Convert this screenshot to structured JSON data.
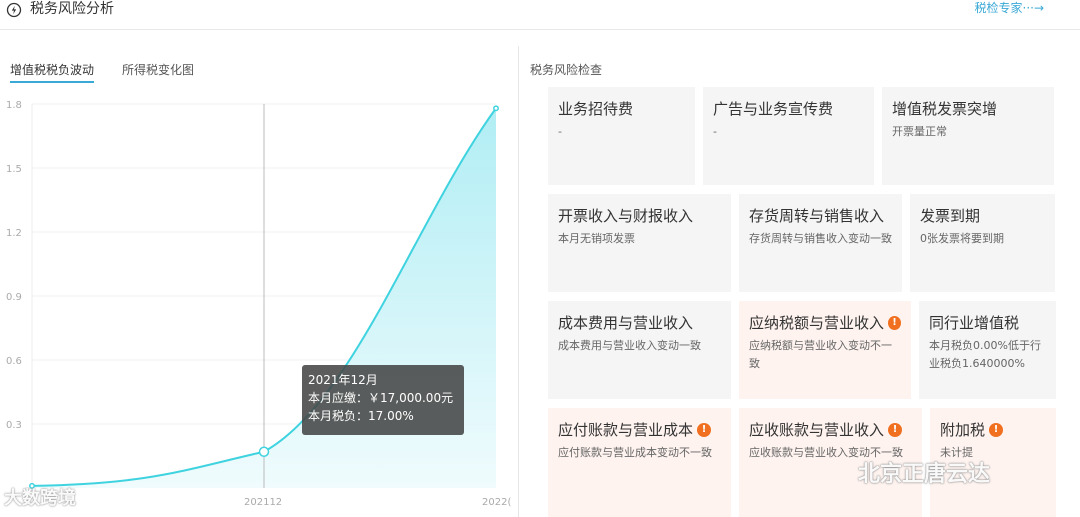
{
  "header": {
    "title": "税务风险分析",
    "icon": "lightning-circle-icon",
    "expert_link": "税检专家···→"
  },
  "tabs": [
    {
      "label": "增值税税负波动",
      "active": true
    },
    {
      "label": "所得税变化图",
      "active": false
    }
  ],
  "chart_data": {
    "type": "area",
    "x": [
      "",
      "202112",
      "2022"
    ],
    "x_tick_labels": [
      "202112",
      "2022("
    ],
    "y_ticks": [
      "1.8",
      "1.5",
      "1.2",
      "0.9",
      "0.6",
      "0.3"
    ],
    "ylim": [
      0,
      1.8
    ],
    "series": [
      {
        "points": [
          [
            0,
            0.01
          ],
          [
            0.5,
            0.17
          ],
          [
            1,
            1.78
          ]
        ]
      }
    ],
    "highlight_index": 1,
    "colors": {
      "line": "#3fd3e0",
      "fill_top": "#a8ecf3",
      "fill_bottom": "#eefbfd",
      "cursor": "#bbbbbb"
    }
  },
  "tooltip": {
    "date": "2021年12月",
    "payable": "本月应缴：￥17,000.00元",
    "burden": "本月税负：17.00%"
  },
  "risk": {
    "title": "税务风险检查",
    "cards": [
      {
        "title": "业务招待费",
        "desc": "-",
        "warn": false
      },
      {
        "title": "广告与业务宣传费",
        "desc": "-",
        "warn": false
      },
      {
        "title": "增值税发票突增",
        "desc": "开票量正常",
        "warn": false
      },
      {
        "title": "开票收入与财报收入",
        "desc": "本月无销项发票",
        "warn": false
      },
      {
        "title": "存货周转与销售收入",
        "desc": "存货周转与销售收入变动一致",
        "warn": false
      },
      {
        "title": "发票到期",
        "desc": "0张发票将要到期",
        "warn": false
      },
      {
        "title": "成本费用与营业收入",
        "desc": "成本费用与营业收入变动一致",
        "warn": false
      },
      {
        "title": "应纳税额与营业收入",
        "desc": "应纳税额与营业收入变动不一致",
        "warn": true
      },
      {
        "title": "同行业增值税",
        "desc": "本月税负0.00%低于行业税负1.640000%",
        "warn": false
      },
      {
        "title": "应付账款与营业成本",
        "desc": "应付账款与营业成本变动不一致",
        "warn": true
      },
      {
        "title": "应收账款与营业收入",
        "desc": "应收账款与营业收入变动不一致",
        "warn": true
      },
      {
        "title": "附加税",
        "desc": "未计提",
        "warn": true
      }
    ]
  },
  "watermarks": {
    "left": "大数跨境",
    "right": "北京正唐云达"
  }
}
